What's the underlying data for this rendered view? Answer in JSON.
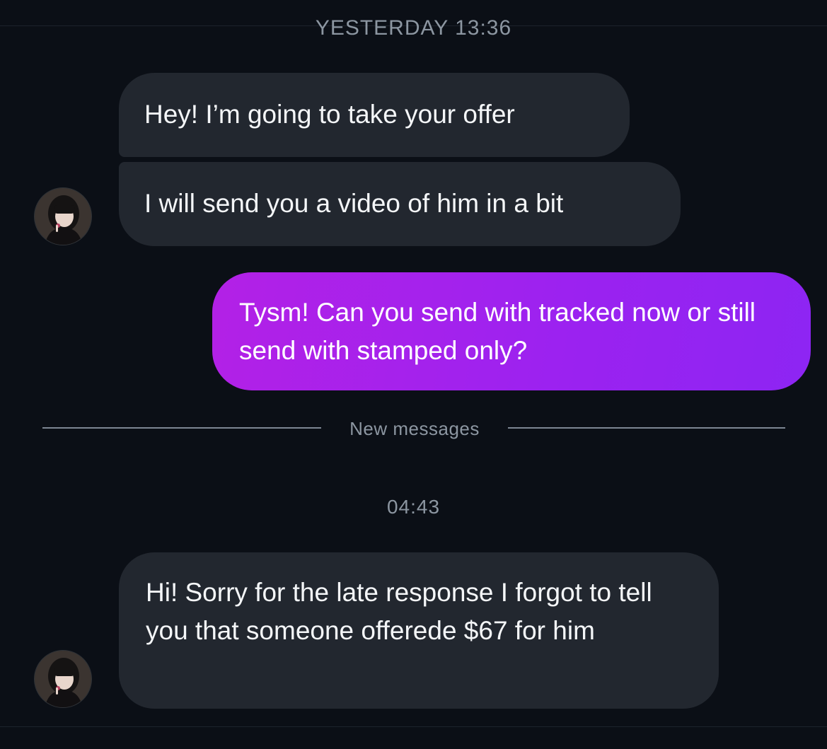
{
  "header": {
    "timestamp_previous": "YESTERDAY 13:36"
  },
  "messages": [
    {
      "direction": "incoming",
      "text": "Hey! I’m going to take your offer"
    },
    {
      "direction": "incoming",
      "text": "I will send you a video of him in a bit"
    },
    {
      "direction": "outgoing",
      "text": "Tysm! Can you send with tracked now or still send with stamped only?"
    },
    {
      "direction": "incoming",
      "text": "Hi! Sorry for the late response I forgot to tell you that someone offerede $67 for him"
    }
  ],
  "divider": {
    "label": "New messages"
  },
  "timestamp_new": "04:43",
  "colors": {
    "background": "#0b0f16",
    "incoming_bubble": "#22272f",
    "outgoing_bubble_start": "#b321e6",
    "outgoing_bubble_end": "#8d25f3",
    "meta_text": "#8c96a1"
  },
  "icons": {
    "contact_avatar": "contact-avatar-photo"
  }
}
